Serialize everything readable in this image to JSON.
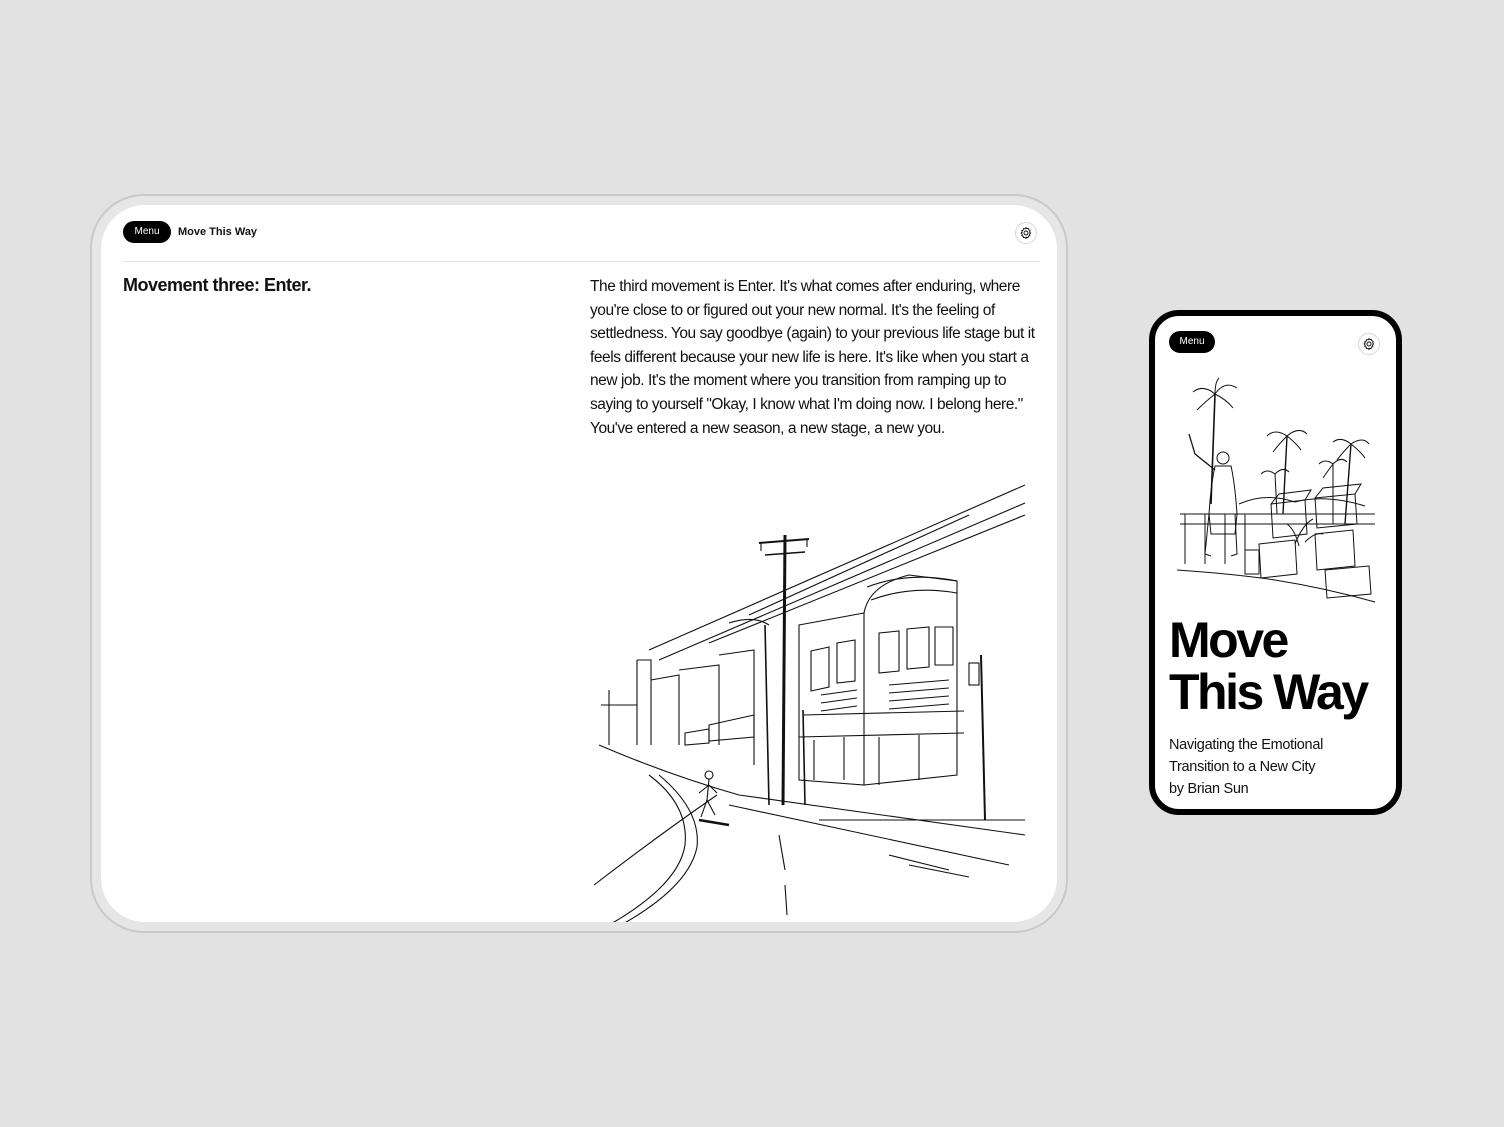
{
  "tablet": {
    "menu_label": "Menu",
    "site_title": "Move This Way",
    "settings_icon": "gear-icon",
    "section_heading": "Movement three: Enter.",
    "body_text": "The third movement is Enter. It's what comes after enduring, where you're close to or figured out your new normal. It's the feeling of settledness. You say goodbye (again) to your previous life stage but it feels different because your new life is here. It's like when you start a new job. It's the moment where you transition from ramping up to saying to yourself \"Okay, I know what I'm doing now. I belong here.\" You've entered a new season, a new stage, a new you.",
    "illustration": "street-corner-sketch"
  },
  "phone": {
    "menu_label": "Menu",
    "settings_icon": "gear-icon",
    "illustration": "man-with-palm-trees-and-boxes-sketch",
    "title_line1": "Move",
    "title_line2": "This Way",
    "subtitle_line1": "Navigating the Emotional",
    "subtitle_line2": "Transition to a New City",
    "byline": "by Brian Sun"
  }
}
